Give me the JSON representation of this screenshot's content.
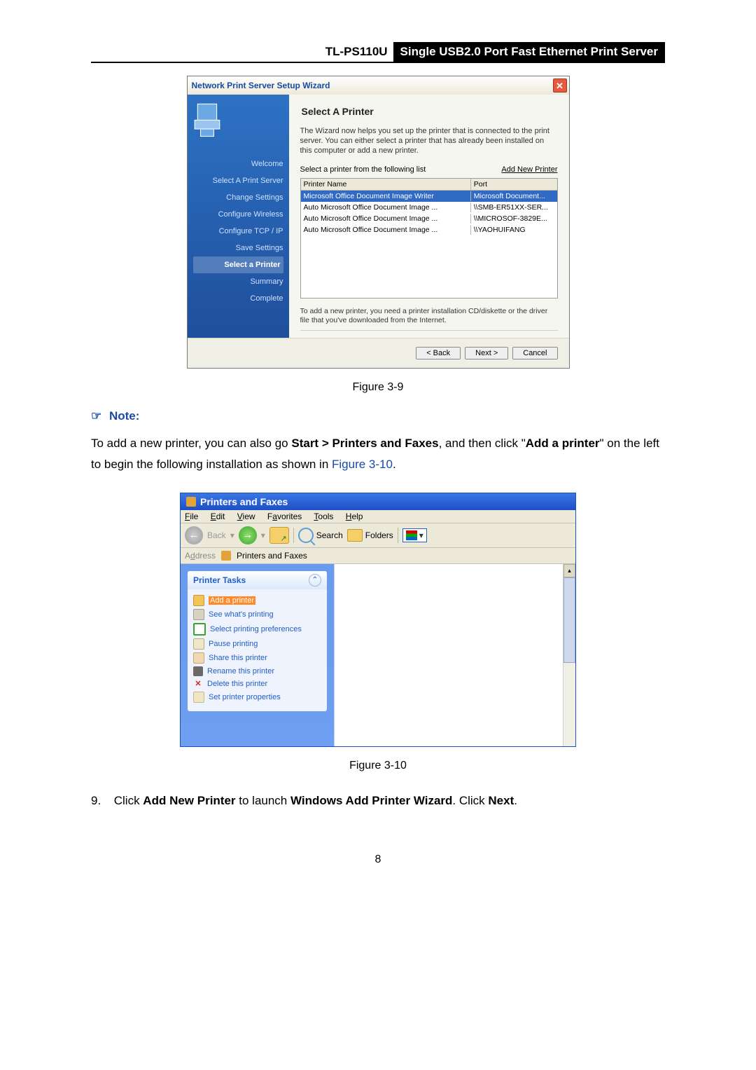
{
  "header": {
    "model": "TL-PS110U",
    "title": "Single USB2.0 Port Fast Ethernet Print Server"
  },
  "wizard": {
    "title": "Network Print Server Setup Wizard",
    "heading": "Select A Printer",
    "desc": "The Wizard now helps you set up the printer that is connected to the print server. You can either select a printer that has already been installed on this computer or add a new printer.",
    "select_label": "Select a printer from the following list",
    "add_btn": "Add New Printer",
    "col_name": "Printer Name",
    "col_port": "Port",
    "rows": [
      {
        "name": "Microsoft Office Document Image Writer",
        "port": "Microsoft Document..."
      },
      {
        "name": "Auto Microsoft Office Document Image ...",
        "port": "\\\\SMB-ER51XX-SER..."
      },
      {
        "name": "Auto Microsoft Office Document Image ...",
        "port": "\\\\MICROSOF-3829E..."
      },
      {
        "name": "Auto Microsoft Office Document Image ...",
        "port": "\\\\YAOHUIFANG"
      }
    ],
    "hint": "To add a new printer, you need a printer installation CD/diskette or the driver file that you've downloaded from the Internet.",
    "steps": [
      "Welcome",
      "Select A Print Server",
      "Change Settings",
      "Configure Wireless",
      "Configure TCP / IP",
      "Save Settings",
      "Select a Printer",
      "Summary",
      "Complete"
    ],
    "back": "< Back",
    "next": "Next >",
    "cancel": "Cancel"
  },
  "fig1": "Figure 3-9",
  "note_title": "Note:",
  "note_body_a": "To add a new printer, you can also go ",
  "note_body_b": "Start > Printers and Faxes",
  "note_body_c": ", and then click \"",
  "note_body_d": "Add a printer",
  "note_body_e": "\" on the left to begin the following installation as shown in ",
  "note_link": "Figure 3-10",
  "note_body_f": ".",
  "pf": {
    "title": "Printers and Faxes",
    "menu": {
      "file": "File",
      "edit": "Edit",
      "view": "View",
      "fav": "Favorites",
      "tools": "Tools",
      "help": "Help"
    },
    "back": "Back",
    "search": "Search",
    "folders": "Folders",
    "addr_lbl": "Address",
    "addr_val": "Printers and Faxes",
    "panel_head": "Printer Tasks",
    "tasks": [
      "Add a printer",
      "See what's printing",
      "Select printing preferences",
      "Pause printing",
      "Share this printer",
      "Rename this printer",
      "Delete this printer",
      "Set printer properties"
    ]
  },
  "fig2": "Figure 3-10",
  "step9_num": "9.",
  "step9_a": "Click ",
  "step9_b": "Add New Printer",
  "step9_c": " to launch ",
  "step9_d": "Windows Add Printer Wizard",
  "step9_e": ". Click ",
  "step9_f": "Next",
  "step9_g": ".",
  "page_num": "8"
}
